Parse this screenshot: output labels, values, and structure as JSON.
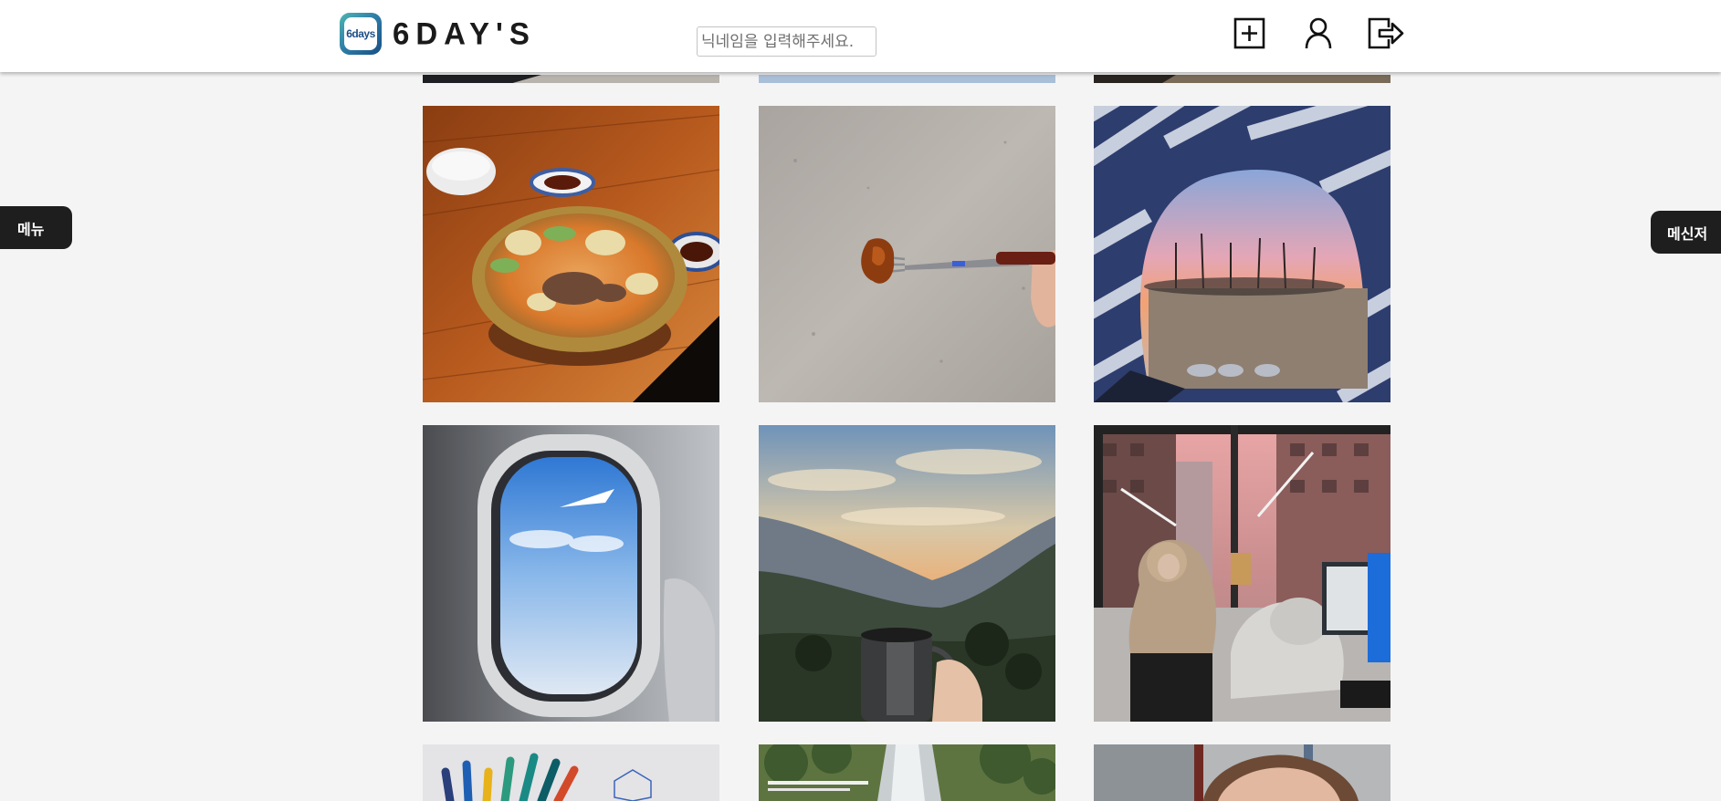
{
  "header": {
    "logo_badge_text": "6days",
    "logo_text": "6DAY'S",
    "search": {
      "placeholder": "닉네임을 입력해주세요.",
      "value": ""
    },
    "icons": [
      "add-post-icon",
      "profile-icon",
      "logout-icon"
    ]
  },
  "side_tabs": {
    "menu_label": "메뉴",
    "messenger_label": "메신저"
  },
  "feed": {
    "photos": [
      {
        "subject": "dark photo (partially visible)"
      },
      {
        "subject": "light blue sky photo (partially visible)"
      },
      {
        "subject": "dark brown photo (partially visible)"
      },
      {
        "subject": "hot pot stew on wooden table"
      },
      {
        "subject": "fried chicken piece on fork over concrete"
      },
      {
        "subject": "sunset view from striped tent"
      },
      {
        "subject": "airplane window with clouds"
      },
      {
        "subject": "mountain sunset with metal mug"
      },
      {
        "subject": "two people sleeping at desk near window"
      },
      {
        "subject": "colored pencils (partially visible)"
      },
      {
        "subject": "waterfall in forest (partially visible)"
      },
      {
        "subject": "person in bus (partially visible)"
      }
    ]
  },
  "colors": {
    "header_bg": "#ffffff",
    "page_bg": "#f4f4f4",
    "tab_bg": "#1e1e1e",
    "logo_blue": "#1d4f86"
  }
}
